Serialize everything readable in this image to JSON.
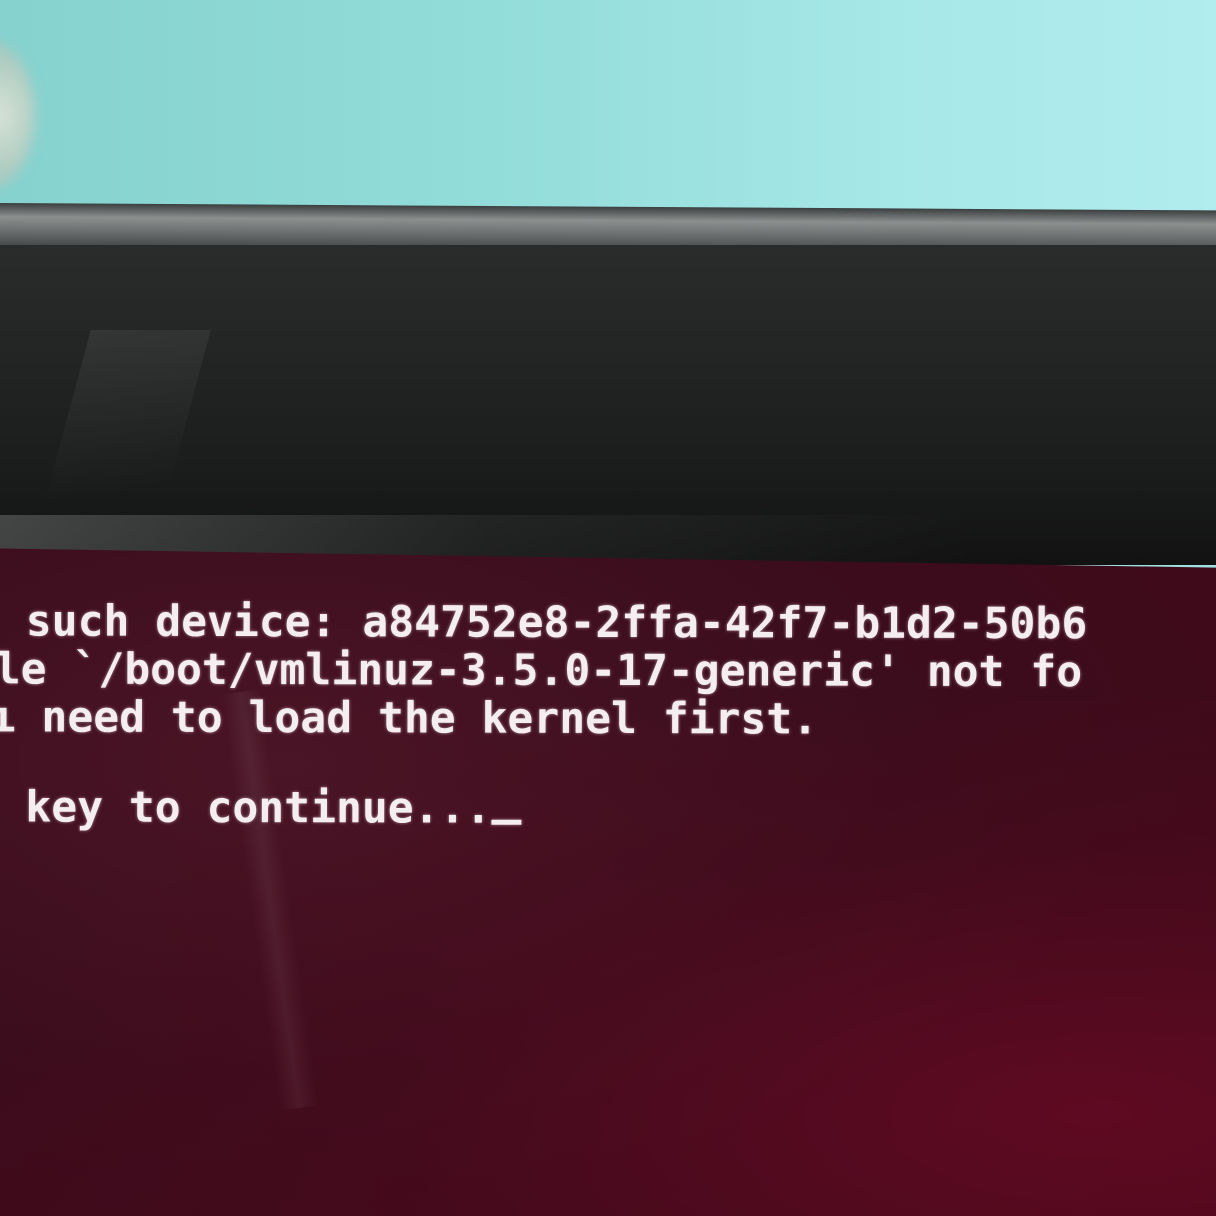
{
  "terminal": {
    "lines": [
      " such device: a84752e8-2ffa-42f7-b1d2-50b6",
      "le `/boot/vmlinuz-3.5.0-17-generic' not fo",
      "ı need to load the kernel first.",
      "",
      " key to continue..."
    ]
  },
  "colors": {
    "screen_background": "#3b0d1d",
    "text": "#f4eef0",
    "bezel": "#1b1c1c",
    "wall": "#9fe0e0"
  }
}
